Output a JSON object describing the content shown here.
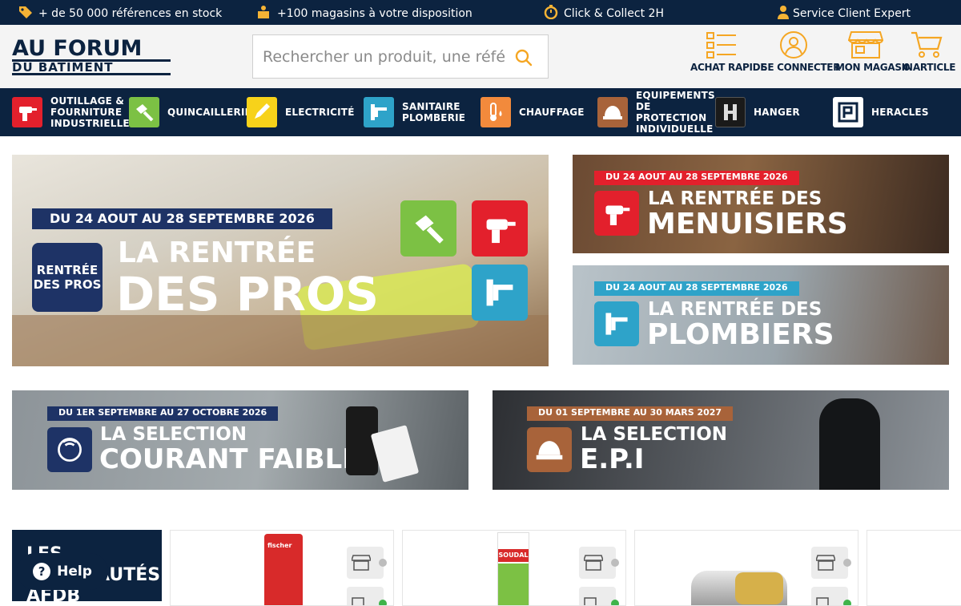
{
  "topbar": {
    "items": [
      {
        "icon": "tag-icon",
        "text": "+ de 50 000 références en stock"
      },
      {
        "icon": "store-person-icon",
        "text": "+100 magasins à votre disposition"
      },
      {
        "icon": "stopwatch-icon",
        "text": "Click & Collect 2H"
      },
      {
        "icon": "user-icon",
        "text": "Service Client Expert"
      }
    ]
  },
  "header": {
    "logo_line1": "AU FORUM",
    "logo_line2": "DU BATIMENT",
    "search_placeholder": "Rechercher un produit, une référence...",
    "actions": [
      {
        "icon": "list-icon",
        "label": "ACHAT RAPIDE"
      },
      {
        "icon": "user-circle-icon",
        "label": "SE CONNECTER"
      },
      {
        "icon": "shop-icon",
        "label": "MON MAGASIN"
      },
      {
        "icon": "cart-icon",
        "label": "0 ARTICLE"
      }
    ]
  },
  "nav": {
    "categories": [
      {
        "label": "OUTILLAGE &\nFOURNITURE\nINDUSTRIELLE",
        "color": "#e3202c",
        "icon": "drill-icon"
      },
      {
        "label": "QUINCAILLERIE",
        "color": "#7cc144",
        "icon": "hammer-icon"
      },
      {
        "label": "ELECTRICITÉ",
        "color": "#f7d21a",
        "icon": "pencil-icon"
      },
      {
        "label": "SANITAIRE\nPLOMBERIE",
        "color": "#2ea3c9",
        "icon": "faucet-icon"
      },
      {
        "label": "CHAUFFAGE",
        "color": "#f28a3c",
        "icon": "thermometer-icon"
      },
      {
        "label": "EQUIPEMENTS\nDE\nPROTECTION\nINDIVIDUELLE",
        "color": "#a8633a",
        "icon": "helmet-icon"
      },
      {
        "label": "HANGER",
        "color": "#1a1a1a",
        "icon": "hanger-logo-icon"
      },
      {
        "label": "HERACLES",
        "color": "#0c2340",
        "icon": "heracles-logo-icon"
      }
    ]
  },
  "banners": {
    "main": {
      "date": "DU 24 AOUT AU 28 SEPTEMBRE 2026",
      "badge": "RENTRÉE\nDES PROS",
      "line1": "LA RENTRÉE",
      "line2": "DES PROS"
    },
    "menuisiers": {
      "date": "DU 24 AOUT AU 28 SEPTEMBRE 2026",
      "line1": "LA RENTRÉE DES",
      "line2": "MENUISIERS"
    },
    "plombiers": {
      "date": "DU 24 AOUT AU 28 SEPTEMBRE 2026",
      "line1": "LA RENTRÉE DES",
      "line2": "PLOMBIERS"
    },
    "courant": {
      "date": "DU 1ER SEPTEMBRE AU 27 OCTOBRE 2026",
      "line1": "LA SELECTION",
      "line2": "COURANT FAIBLE"
    },
    "epi": {
      "date": "DU 01 SEPTEMBRE AU 30 MARS 2027",
      "line1": "LA SELECTION",
      "line2": "E.P.I"
    }
  },
  "promo": {
    "text": "LES\nNOUVEAUTÉS\nAFDB"
  },
  "products": [
    {
      "brand": "fischer",
      "stock_color": "#bdbdbd",
      "delivery_color": "#3fb44a"
    },
    {
      "brand": "SOUDAL",
      "stock_color": "#bdbdbd",
      "delivery_color": "#3fb44a"
    },
    {
      "brand": "",
      "stock_color": "#bdbdbd",
      "delivery_color": "#3fb44a"
    }
  ],
  "help": {
    "label": "Help"
  }
}
